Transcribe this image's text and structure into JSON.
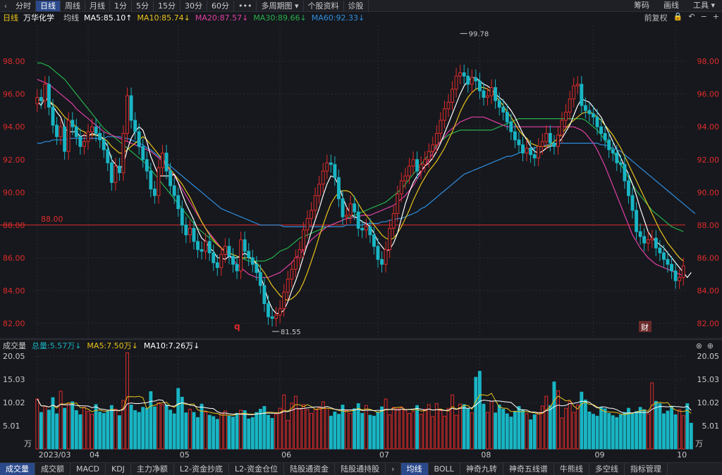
{
  "topbar": {
    "tabs": [
      "分时",
      "日线",
      "周线",
      "月线",
      "1分",
      "5分",
      "15分",
      "30分",
      "60分",
      "•••",
      "多周期图 ▾",
      "个股资料",
      "诊股"
    ],
    "active_tab": "日线",
    "right": [
      "筹码",
      "画线",
      "工具 ▾"
    ]
  },
  "header": {
    "period": "日线",
    "stock_name": "万华化学",
    "ma_label": "均线",
    "ma5": "MA5:85.10↑",
    "ma10": "MA10:85.74↓",
    "ma20": "MA20:87.57↓",
    "ma30": "MA30:89.66↓",
    "ma60": "MA60:92.33↓",
    "adjust": "前复权"
  },
  "volume_header": {
    "title": "成交量",
    "total": "总量:5.57万↓",
    "ma5": "MA5:7.50万↓",
    "ma10": "MA10:7.26万↓"
  },
  "bottombar": {
    "left_tabs": [
      "成交量",
      "成交额",
      "MACD",
      "KDJ",
      "主力净额",
      "L2-资金抄底",
      "L2-资金仓位",
      "陆股通资金",
      "陆股通持股"
    ],
    "right_tabs": [
      "均线",
      "BOLL",
      "神奇九转",
      "神奇五线谱",
      "牛熊线",
      "多空线",
      "指标管理"
    ]
  },
  "colors": {
    "up": "#e02b2b",
    "down": "#19b5c4",
    "ma5": "#ffffff",
    "ma10": "#e8c21c",
    "ma20": "#e03fa4",
    "ma30": "#27b04b",
    "ma60": "#2f8ee0",
    "ref_line": "#e02b2b"
  },
  "chart_data": [
    {
      "type": "candlestick",
      "ylim": [
        81.2,
        100.2
      ],
      "y_ticks": [
        "98.00",
        "96.00",
        "94.00",
        "92.00",
        "90.00",
        "88.00",
        "86.00",
        "84.00",
        "82.00"
      ],
      "y_tick_values": [
        98,
        96,
        94,
        92,
        90,
        88,
        86,
        84,
        82
      ],
      "x_labels": [
        "2023/03",
        "04",
        "05",
        "06",
        "07",
        "08",
        "09",
        "10"
      ],
      "x_label_index": [
        0,
        13,
        36,
        62,
        87,
        113,
        142,
        163
      ],
      "reference_line": {
        "value": 88.0,
        "label": "88.00"
      },
      "annotations": {
        "high": "99.78",
        "low": "81.55",
        "marker_q": "q",
        "marker_cai": "财"
      },
      "closes": [
        95.8,
        95.6,
        96.6,
        95.2,
        94.1,
        93.4,
        94.0,
        92.5,
        94.4,
        94.0,
        93.4,
        92.8,
        93.1,
        93.7,
        94.0,
        93.6,
        93.2,
        92.6,
        91.8,
        90.6,
        91.6,
        91.2,
        93.6,
        95.9,
        94.4,
        93.7,
        92.8,
        92.0,
        91.3,
        90.2,
        89.8,
        91.5,
        92.4,
        91.3,
        90.4,
        89.8,
        89.0,
        88.0,
        87.4,
        87.8,
        87.0,
        86.5,
        86.4,
        87.0,
        86.3,
        85.7,
        85.4,
        86.2,
        86.7,
        86.1,
        85.6,
        85.2,
        87.1,
        86.4,
        86.0,
        85.6,
        85.1,
        84.3,
        83.2,
        82.4,
        82.3,
        82.5,
        82.9,
        83.9,
        84.7,
        85.3,
        86.0,
        86.5,
        87.7,
        88.4,
        88.9,
        89.8,
        90.5,
        91.3,
        91.8,
        91.7,
        90.9,
        89.6,
        88.5,
        88.6,
        89.3,
        88.8,
        87.8,
        87.7,
        87.9,
        87.4,
        86.7,
        85.9,
        85.6,
        86.5,
        87.8,
        88.7,
        89.9,
        90.7,
        91.0,
        91.6,
        92.0,
        91.3,
        91.7,
        92.0,
        92.5,
        92.9,
        93.6,
        94.4,
        95.1,
        95.5,
        96.3,
        97.1,
        97.3,
        97.1,
        96.6,
        97.0,
        96.8,
        96.2,
        95.8,
        95.9,
        96.4,
        95.6,
        95.2,
        94.9,
        94.3,
        93.7,
        93.2,
        92.9,
        92.4,
        92.7,
        92.3,
        92.1,
        92.8,
        93.1,
        93.6,
        93.0,
        92.8,
        93.5,
        94.4,
        94.9,
        95.7,
        96.5,
        96.6,
        95.3,
        95.0,
        94.8,
        94.6,
        94.0,
        93.6,
        93.2,
        92.6,
        92.4,
        91.8,
        91.7,
        90.7,
        89.8,
        88.9,
        87.6,
        87.3,
        86.9,
        87.1,
        87.2,
        86.6,
        86.3,
        85.9,
        85.6,
        85.2,
        84.6,
        84.8,
        85.5
      ],
      "ma5": [
        95.6,
        95.3,
        95.8,
        95.6,
        95.3,
        94.9,
        94.6,
        93.9,
        93.7,
        93.7,
        93.7,
        93.4,
        93.5,
        93.4,
        93.6,
        93.5,
        93.5,
        93.2,
        92.8,
        92.0,
        91.7,
        91.4,
        91.7,
        92.6,
        93.3,
        93.7,
        94.0,
        93.8,
        93.1,
        92.2,
        91.6,
        91.0,
        91.0,
        91.0,
        91.0,
        91.1,
        90.6,
        89.9,
        89.3,
        88.8,
        88.3,
        87.7,
        87.2,
        87.0,
        86.6,
        86.4,
        86.0,
        86.0,
        85.9,
        86.1,
        86.0,
        86.0,
        86.1,
        86.3,
        86.1,
        85.9,
        85.6,
        84.9,
        84.2,
        83.4,
        82.9,
        82.6,
        82.6,
        82.8,
        83.3,
        84.0,
        84.6,
        85.3,
        86.1,
        86.8,
        87.6,
        88.3,
        89.0,
        89.8,
        90.5,
        91.0,
        90.9,
        90.4,
        89.7,
        89.1,
        88.7,
        88.5,
        88.4,
        88.2,
        88.1,
        87.9,
        87.5,
        87.0,
        86.7,
        86.4,
        86.5,
        86.9,
        87.5,
        88.4,
        89.3,
        90.0,
        90.6,
        91.0,
        91.3,
        91.6,
        91.8,
        92.1,
        92.5,
        93.0,
        93.6,
        94.2,
        94.8,
        95.4,
        96.0,
        96.5,
        96.8,
        97.0,
        97.0,
        96.8,
        96.6,
        96.5,
        96.3,
        96.0,
        95.8,
        95.6,
        95.3,
        95.0,
        94.6,
        94.1,
        93.6,
        93.2,
        92.8,
        92.5,
        92.4,
        92.5,
        92.7,
        92.8,
        92.9,
        93.0,
        93.3,
        93.7,
        94.1,
        94.7,
        95.3,
        95.7,
        95.6,
        95.5,
        95.2,
        94.9,
        94.6,
        94.1,
        93.6,
        93.1,
        92.6,
        92.1,
        91.6,
        91.1,
        90.5,
        89.8,
        89.0,
        88.3,
        87.6,
        87.2,
        87.0,
        86.8,
        86.6,
        86.3,
        86.0,
        85.7,
        85.4,
        85.1,
        84.8,
        85.1
      ],
      "ma10": [
        95.7,
        95.6,
        95.7,
        95.6,
        95.4,
        95.2,
        94.9,
        94.6,
        94.4,
        94.2,
        94.0,
        93.8,
        93.7,
        93.5,
        93.5,
        93.5,
        93.4,
        93.3,
        93.1,
        92.8,
        92.6,
        92.4,
        92.4,
        92.6,
        92.8,
        93.0,
        93.2,
        93.4,
        93.2,
        92.9,
        92.6,
        92.3,
        92.0,
        91.7,
        91.4,
        91.1,
        90.8,
        90.5,
        90.1,
        89.7,
        89.2,
        88.7,
        88.2,
        87.8,
        87.4,
        87.1,
        86.8,
        86.6,
        86.4,
        86.3,
        86.2,
        86.1,
        86.0,
        86.0,
        86.0,
        85.9,
        85.7,
        85.4,
        85.1,
        84.7,
        84.3,
        84.0,
        83.7,
        83.5,
        83.4,
        83.5,
        83.7,
        84.0,
        84.5,
        85.1,
        85.8,
        86.5,
        87.3,
        88.0,
        88.7,
        89.3,
        89.7,
        90.0,
        90.1,
        90.1,
        90.0,
        89.7,
        89.3,
        88.9,
        88.6,
        88.3,
        88.0,
        87.7,
        87.4,
        87.2,
        87.1,
        87.2,
        87.5,
        87.9,
        88.4,
        88.9,
        89.5,
        90.0,
        90.5,
        90.9,
        91.3,
        91.6,
        91.9,
        92.3,
        92.7,
        93.2,
        93.7,
        94.3,
        94.9,
        95.4,
        95.8,
        96.1,
        96.3,
        96.4,
        96.4,
        96.3,
        96.1,
        95.9,
        95.6,
        95.3,
        94.9,
        94.6,
        94.2,
        93.8,
        93.5,
        93.3,
        93.0,
        92.9,
        92.8,
        92.8,
        92.8,
        92.9,
        93.1,
        93.3,
        93.6,
        93.9,
        94.2,
        94.4,
        94.6,
        94.8,
        94.9,
        94.9,
        94.8,
        94.6,
        94.4,
        94.1,
        93.8,
        93.5,
        93.1,
        92.7,
        92.2,
        91.7,
        91.2,
        90.7,
        90.2,
        89.7,
        89.2,
        88.7,
        88.2,
        87.7,
        87.3,
        86.9,
        86.6,
        86.3,
        86.0,
        85.8
      ],
      "ma20": [
        96.9,
        96.8,
        96.7,
        96.6,
        96.4,
        96.2,
        96.0,
        95.8,
        95.6,
        95.4,
        95.1,
        94.9,
        94.7,
        94.5,
        94.3,
        94.1,
        93.9,
        93.7,
        93.6,
        93.5,
        93.4,
        93.3,
        93.2,
        93.1,
        93.0,
        92.9,
        92.8,
        92.7,
        92.6,
        92.5,
        92.3,
        92.1,
        91.9,
        91.6,
        91.3,
        91.0,
        90.6,
        90.2,
        89.8,
        89.4,
        89.0,
        88.6,
        88.2,
        87.8,
        87.5,
        87.2,
        86.9,
        86.6,
        86.3,
        86.1,
        85.9,
        85.6,
        85.4,
        85.2,
        85.0,
        84.9,
        84.8,
        84.8,
        84.8,
        84.8,
        84.9,
        85.0,
        85.1,
        85.3,
        85.5,
        85.7,
        86.0,
        86.2,
        86.5,
        86.8,
        87.1,
        87.3,
        87.5,
        87.7,
        87.9,
        88.0,
        88.1,
        88.2,
        88.3,
        88.4,
        88.4,
        88.5,
        88.5,
        88.6,
        88.6,
        88.6,
        88.7,
        88.8,
        88.9,
        89.0,
        89.1,
        89.2,
        89.4,
        89.6,
        89.8,
        90.1,
        90.4,
        90.8,
        91.2,
        91.6,
        92.0,
        92.4,
        92.8,
        93.1,
        93.4,
        93.7,
        93.9,
        94.1,
        94.3,
        94.4,
        94.5,
        94.6,
        94.6,
        94.6,
        94.6,
        94.5,
        94.4,
        94.3,
        94.2,
        94.1,
        94.0,
        94.0,
        94.0,
        94.0,
        94.0,
        94.0,
        94.0,
        94.0,
        94.0,
        94.0,
        94.0,
        94.0,
        94.0,
        94.0,
        94.0,
        94.0,
        94.0,
        94.0,
        93.9,
        93.8,
        93.6,
        93.3,
        93.0,
        92.6,
        92.1,
        91.6,
        91.0,
        90.4,
        89.8,
        89.2,
        88.6,
        88.0,
        87.4,
        87.0,
        86.6,
        86.3,
        86.0,
        85.8,
        85.6,
        85.5,
        85.4,
        85.3,
        85.2,
        85.1,
        85.0,
        84.9
      ],
      "ma30": [
        97.9,
        97.9,
        97.8,
        97.7,
        97.5,
        97.3,
        97.1,
        96.9,
        96.6,
        96.3,
        96.0,
        95.7,
        95.4,
        95.1,
        94.8,
        94.5,
        94.2,
        93.9,
        93.7,
        93.5,
        93.3,
        93.1,
        92.9,
        92.7,
        92.5,
        92.3,
        92.1,
        91.9,
        91.7,
        91.4,
        91.1,
        90.8,
        90.5,
        90.2,
        89.9,
        89.6,
        89.3,
        89.0,
        88.7,
        88.4,
        88.1,
        87.8,
        87.6,
        87.4,
        87.2,
        87.0,
        86.8,
        86.6,
        86.4,
        86.3,
        86.2,
        86.1,
        86.0,
        85.9,
        85.8,
        85.8,
        85.8,
        85.8,
        85.8,
        85.9,
        86.0,
        86.2,
        86.4,
        86.5,
        86.6,
        86.8,
        87.0,
        87.2,
        87.3,
        87.4,
        87.5,
        87.6,
        87.7,
        87.8,
        87.9,
        88.0,
        88.1,
        88.2,
        88.3,
        88.4,
        88.5,
        88.6,
        88.7,
        88.8,
        88.9,
        89.0,
        89.1,
        89.2,
        89.3,
        89.4,
        89.6,
        89.8,
        90.0,
        90.2,
        90.5,
        90.8,
        91.1,
        91.4,
        91.7,
        92.0,
        92.3,
        92.6,
        92.9,
        93.1,
        93.3,
        93.5,
        93.6,
        93.7,
        93.8,
        93.8,
        93.8,
        93.8,
        93.8,
        93.8,
        93.8,
        93.8,
        93.8,
        93.9,
        94.0,
        94.1,
        94.2,
        94.3,
        94.4,
        94.5,
        94.5,
        94.5,
        94.5,
        94.5,
        94.5,
        94.5,
        94.5,
        94.5,
        94.5,
        94.5,
        94.5,
        94.5,
        94.5,
        94.5,
        94.5,
        94.5,
        94.4,
        94.2,
        94.0,
        93.8,
        93.5,
        93.2,
        92.9,
        92.5,
        92.1,
        91.7,
        91.3,
        90.9,
        90.5,
        90.1,
        89.8,
        89.5,
        89.2,
        88.9,
        88.7,
        88.5,
        88.3,
        88.1,
        87.9,
        87.8,
        87.7,
        87.6
      ],
      "ma60": [
        93.0,
        93.0,
        93.1,
        93.1,
        93.2,
        93.2,
        93.2,
        93.2,
        93.3,
        93.3,
        93.3,
        93.3,
        93.3,
        93.3,
        93.3,
        93.3,
        93.3,
        93.3,
        93.4,
        93.4,
        93.4,
        93.4,
        93.3,
        93.3,
        93.2,
        93.1,
        93.0,
        92.9,
        92.7,
        92.6,
        92.4,
        92.2,
        92.0,
        91.8,
        91.6,
        91.4,
        91.2,
        91.0,
        90.8,
        90.6,
        90.4,
        90.2,
        90.0,
        89.8,
        89.6,
        89.4,
        89.2,
        89.0,
        88.9,
        88.8,
        88.7,
        88.6,
        88.5,
        88.4,
        88.3,
        88.2,
        88.1,
        88.0,
        88.0,
        88.0,
        88.0,
        88.0,
        88.0,
        87.9,
        87.9,
        87.9,
        87.9,
        87.9,
        87.9,
        87.9,
        87.9,
        87.9,
        87.9,
        87.9,
        87.9,
        87.9,
        87.9,
        87.9,
        87.9,
        88.0,
        88.0,
        88.0,
        88.0,
        88.0,
        88.1,
        88.1,
        88.1,
        88.1,
        88.2,
        88.2,
        88.3,
        88.3,
        88.4,
        88.4,
        88.5,
        88.6,
        88.7,
        88.8,
        89.0,
        89.1,
        89.3,
        89.5,
        89.7,
        89.9,
        90.1,
        90.3,
        90.5,
        90.7,
        90.9,
        91.1,
        91.2,
        91.3,
        91.4,
        91.5,
        91.6,
        91.7,
        91.8,
        91.9,
        92.0,
        92.1,
        92.2,
        92.2,
        92.3,
        92.4,
        92.5,
        92.6,
        92.7,
        92.7,
        92.8,
        92.8,
        92.9,
        92.9,
        93.0,
        93.0,
        93.0,
        93.0,
        93.0,
        93.0,
        93.0,
        93.0,
        93.0,
        93.0,
        93.0,
        93.0,
        92.9,
        92.9,
        92.8,
        92.7,
        92.6,
        92.5,
        92.3,
        92.1,
        91.9,
        91.7,
        91.5,
        91.3,
        91.1,
        90.9,
        90.7,
        90.5,
        90.3,
        90.1,
        89.9,
        89.7,
        89.5,
        89.3,
        89.1,
        88.9,
        88.7
      ]
    },
    {
      "type": "bar",
      "unit": "万",
      "ylim": [
        0,
        21
      ],
      "y_ticks": [
        "20.05",
        "15.03",
        "10.02",
        "5.01"
      ],
      "y_tick_values": [
        20.05,
        15.03,
        10.02,
        5.01
      ],
      "values": [
        10.8,
        7.9,
        9.2,
        8.4,
        11.1,
        7.6,
        12.5,
        8.8,
        9.9,
        10.2,
        8.3,
        7.4,
        9.0,
        8.1,
        7.5,
        9.6,
        8.0,
        7.7,
        8.2,
        9.4,
        8.6,
        7.2,
        10.5,
        20.8,
        9.5,
        8.3,
        7.9,
        9.0,
        8.8,
        12.4,
        9.1,
        10.0,
        9.6,
        9.5,
        8.4,
        7.6,
        13.1,
        11.2,
        7.8,
        8.6,
        7.9,
        6.8,
        9.7,
        8.0,
        7.3,
        7.0,
        6.4,
        7.8,
        8.2,
        7.1,
        6.9,
        7.7,
        8.4,
        8.3,
        6.5,
        6.8,
        7.9,
        8.6,
        9.2,
        7.3,
        6.6,
        7.5,
        8.8,
        11.7,
        6.2,
        9.9,
        11.4,
        8.6,
        9.6,
        8.5,
        7.7,
        8.5,
        8.9,
        10.2,
        8.8,
        7.1,
        8.0,
        7.5,
        9.5,
        8.3,
        7.7,
        8.7,
        9.8,
        7.7,
        9.4,
        7.3,
        7.1,
        8.0,
        9.1,
        10.8,
        7.4,
        9.0,
        8.7,
        9.1,
        8.4,
        7.7,
        8.1,
        9.4,
        7.5,
        8.6,
        9.6,
        7.0,
        9.8,
        8.3,
        7.1,
        8.8,
        11.7,
        7.3,
        9.7,
        9.6,
        8.7,
        7.8,
        15.5,
        16.8,
        9.7,
        7.9,
        10.3,
        7.8,
        9.5,
        8.6,
        7.6,
        6.9,
        8.1,
        9.2,
        8.5,
        7.6,
        6.3,
        7.4,
        7.9,
        9.3,
        11.4,
        9.4,
        14.5,
        12.6,
        6.7,
        8.8,
        10.3,
        7.9,
        9.5,
        12.3,
        10.6,
        8.0,
        7.5,
        7.1,
        9.0,
        8.7,
        7.7,
        7.2,
        6.8,
        7.4,
        7.9,
        8.8,
        7.6,
        8.1,
        9.0,
        8.5,
        7.6,
        14.3,
        10.3,
        9.8,
        7.6,
        8.2,
        9.1,
        7.4,
        8.5,
        7.2,
        9.8,
        5.57
      ]
    }
  ]
}
